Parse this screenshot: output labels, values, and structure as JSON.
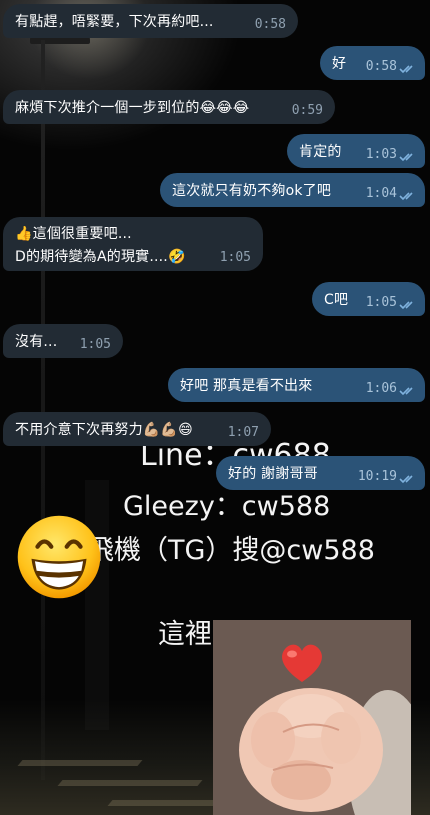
{
  "messages": [
    {
      "text": "有點趕，唔緊要，下次再約吧...",
      "time": "0:58"
    },
    {
      "text": "好",
      "time": "0:58"
    },
    {
      "text": "麻煩下次推介一個一步到位的😂😂😂",
      "time": "0:59"
    },
    {
      "text": "肯定的",
      "time": "1:03"
    },
    {
      "text": "這次就只有奶不夠ok了吧",
      "time": "1:04"
    },
    {
      "line1": "👍這個很重要吧...",
      "line2": "D的期待變為A的現實....🤣",
      "time": "1:05"
    },
    {
      "text": "C吧",
      "time": "1:05"
    },
    {
      "text": "沒有...",
      "time": "1:05"
    },
    {
      "text": "好吧    那真是看不出來",
      "time": "1:06"
    },
    {
      "text": "不用介意下次再努力💪🏼💪🏼😄",
      "time": "1:07"
    },
    {
      "text": "好的   謝謝哥哥",
      "time": "10:19"
    }
  ],
  "background_text": {
    "line1": "Line：cw688",
    "line2": "Gleezy：cw588",
    "line3": "飛機（TG）搜@cw588",
    "line4": "這裡是子現"
  },
  "colors": {
    "incoming_bubble": "#222b34",
    "outgoing_bubble": "#2b5377",
    "read_ticks": "#7fb2de"
  },
  "icons": {
    "ticks": "double-check-icon",
    "big_emoji": "grinning-face-icon",
    "heart": "red-heart-icon"
  }
}
